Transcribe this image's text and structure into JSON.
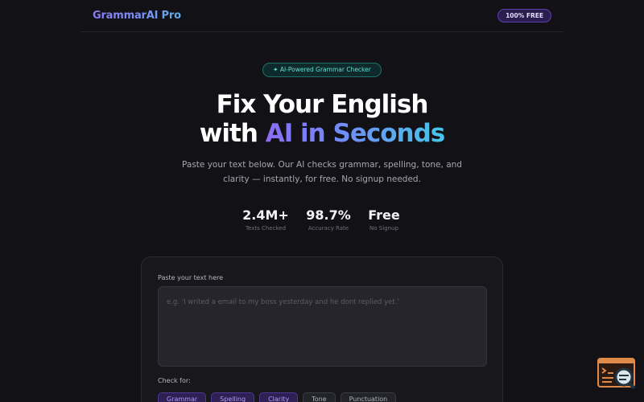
{
  "header": {
    "brand": "GrammarAI Pro",
    "badge": "100% FREE"
  },
  "hero": {
    "pill": "✦ AI-Powered Grammar Checker",
    "headline_line1": "Fix Your English",
    "headline_line2_plain": "with ",
    "headline_line2_accent": "AI in Seconds",
    "subtitle": "Paste your text below. Our AI checks grammar, spelling, tone, and clarity — instantly, for free. No signup needed."
  },
  "stats": [
    {
      "value": "2.4M+",
      "label": "Texts Checked"
    },
    {
      "value": "98.7%",
      "label": "Accuracy Rate"
    },
    {
      "value": "Free",
      "label": "No Signup"
    }
  ],
  "editor": {
    "label": "Paste your text here",
    "placeholder": "e.g. 'I writed a email to my boss yesterday and he dont replied yet.'",
    "value": "",
    "check_for_label": "Check for:",
    "options": [
      {
        "label": "Grammar",
        "selected": true
      },
      {
        "label": "Spelling",
        "selected": true
      },
      {
        "label": "Clarity",
        "selected": true
      },
      {
        "label": "Tone",
        "selected": false
      },
      {
        "label": "Punctuation",
        "selected": false
      }
    ]
  },
  "colors": {
    "background": "#121216",
    "accent_purple": "#8b6cf6",
    "accent_cyan": "#46c6e8",
    "badge_purple": "#2a1e4e",
    "pill_teal": "#5fe0d0",
    "widget_orange": "#e08a4a"
  },
  "icons": {
    "floating_widget": "terminal-search-icon"
  }
}
